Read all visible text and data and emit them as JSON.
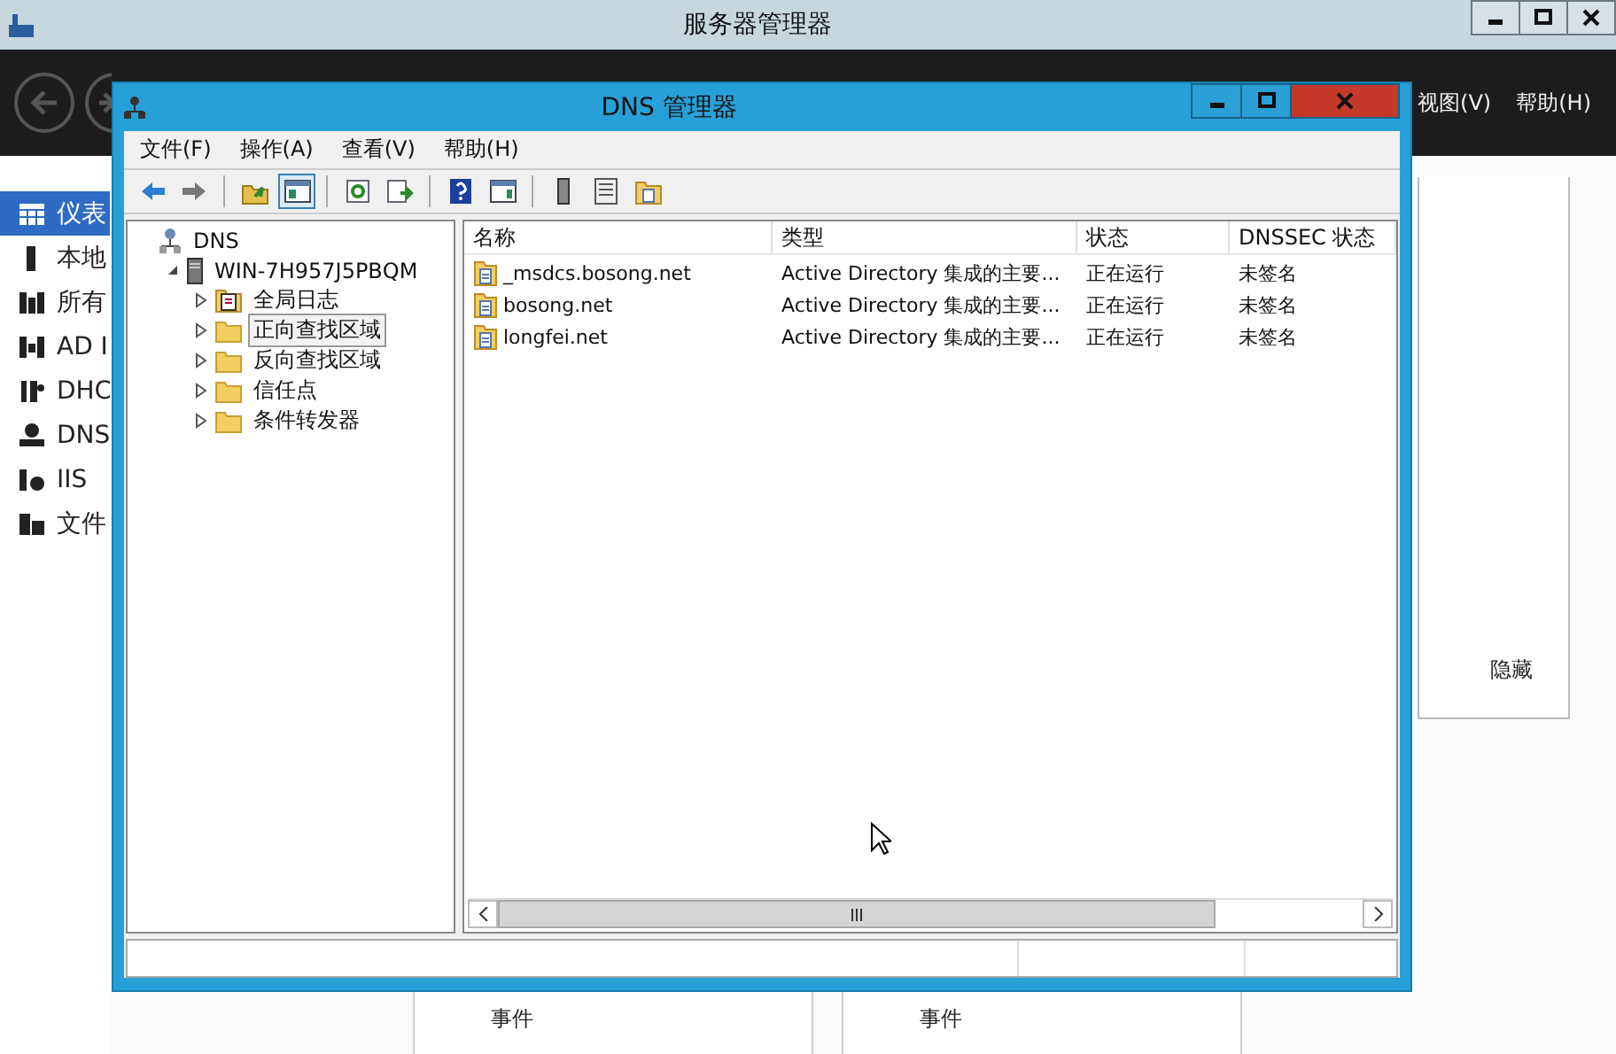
{
  "server_manager": {
    "title": "服务器管理器",
    "menu": [
      "视图(V)",
      "帮助(H)"
    ],
    "sidebar": [
      {
        "label": "仪表",
        "kind": "dashboard",
        "selected": true
      },
      {
        "label": "本地",
        "kind": "local",
        "selected": false
      },
      {
        "label": "所有",
        "kind": "all",
        "selected": false
      },
      {
        "label": "AD I",
        "kind": "ad",
        "selected": false
      },
      {
        "label": "DHC",
        "kind": "dhcp",
        "selected": false
      },
      {
        "label": "DNS",
        "kind": "dns",
        "selected": false
      },
      {
        "label": "IIS",
        "kind": "iis",
        "selected": false
      },
      {
        "label": "文件",
        "kind": "files",
        "selected": false
      }
    ],
    "hide_label": "隐藏",
    "tiles": [
      {
        "label": "事件"
      },
      {
        "label": "事件"
      }
    ]
  },
  "dns_window": {
    "title": "DNS 管理器",
    "menu": [
      "文件(F)",
      "操作(A)",
      "查看(V)",
      "帮助(H)"
    ],
    "toolbar": [
      {
        "kind": "back",
        "pressed": false
      },
      {
        "kind": "forward",
        "pressed": false
      },
      {
        "kind": "sep"
      },
      {
        "kind": "up",
        "pressed": false
      },
      {
        "kind": "tree",
        "pressed": true
      },
      {
        "kind": "sep"
      },
      {
        "kind": "refresh",
        "pressed": false
      },
      {
        "kind": "export",
        "pressed": false
      },
      {
        "kind": "sep"
      },
      {
        "kind": "help",
        "pressed": false
      },
      {
        "kind": "pane",
        "pressed": false
      },
      {
        "kind": "sep"
      },
      {
        "kind": "server",
        "pressed": false
      },
      {
        "kind": "list",
        "pressed": false
      },
      {
        "kind": "zone",
        "pressed": false
      }
    ],
    "tree": [
      {
        "label": "DNS",
        "kind": "dns",
        "selected": false,
        "children": [
          {
            "label": "WIN-7H957J5PBQM",
            "kind": "server",
            "selected": false,
            "expanded": true,
            "children": [
              {
                "label": "全局日志",
                "kind": "log",
                "selected": false,
                "expanded": false
              },
              {
                "label": "正向查找区域",
                "kind": "folder",
                "selected": true,
                "expanded": false
              },
              {
                "label": "反向查找区域",
                "kind": "folder",
                "selected": false,
                "expanded": false
              },
              {
                "label": "信任点",
                "kind": "folder",
                "selected": false,
                "expanded": false
              },
              {
                "label": "条件转发器",
                "kind": "folder",
                "selected": false,
                "expanded": false
              }
            ]
          }
        ]
      }
    ],
    "list": {
      "columns": [
        "名称",
        "类型",
        "状态",
        "DNSSEC 状态"
      ],
      "rows": [
        {
          "cells": [
            "_msdcs.bosong.net",
            "Active Directory 集成的主要...",
            "正在运行",
            "未签名"
          ]
        },
        {
          "cells": [
            "bosong.net",
            "Active Directory 集成的主要...",
            "正在运行",
            "未签名"
          ]
        },
        {
          "cells": [
            "longfei.net",
            "Active Directory 集成的主要...",
            "正在运行",
            "未签名"
          ]
        }
      ]
    }
  }
}
